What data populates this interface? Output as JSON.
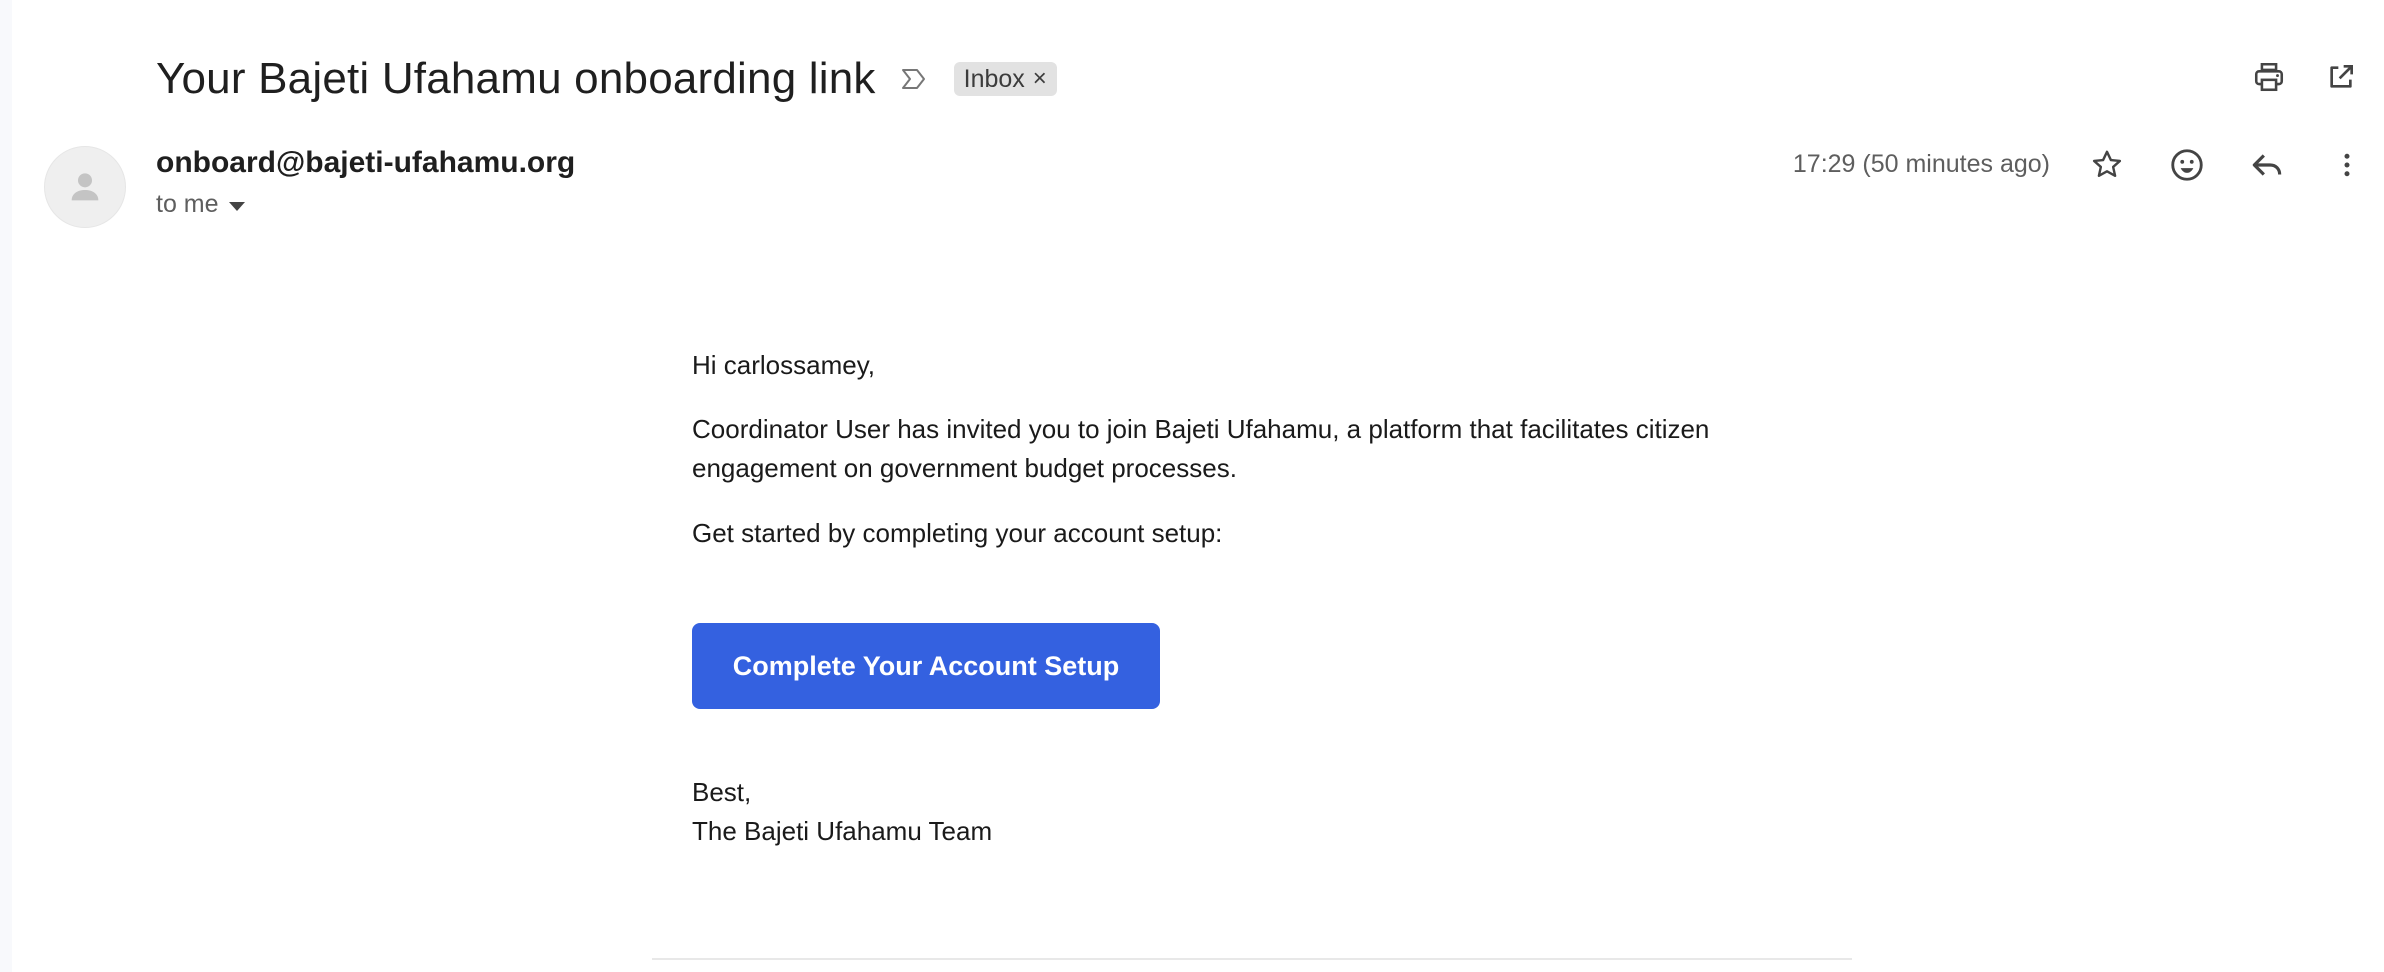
{
  "email": {
    "subject": "Your Bajeti Ufahamu onboarding link",
    "label": "Inbox",
    "label_remove": "×",
    "sender": "onboard@bajeti-ufahamu.org",
    "recipient": "to me",
    "time": "17:29 (50 minutes ago)"
  },
  "icons": {
    "importance": "importance-marker-icon",
    "print": "print-icon",
    "open_new_window": "open-in-new-window-icon",
    "star": "star-icon",
    "emoji": "emoji-reaction-icon",
    "reply": "reply-icon",
    "more": "more-vert-icon",
    "avatar": "person-icon"
  },
  "body": {
    "greeting": "Hi carlossamey,",
    "paragraph1": "Coordinator User has invited you to join Bajeti Ufahamu, a platform that facilitates citizen engagement on government budget processes.",
    "paragraph2": "Get started by completing your account setup:",
    "cta_label": "Complete Your Account Setup",
    "signoff_line1": "Best,",
    "signoff_line2": "The Bajeti Ufahamu Team"
  },
  "colors": {
    "cta_background": "#3461e0",
    "cta_text": "#ffffff",
    "chip_background": "#e2e2e2"
  }
}
